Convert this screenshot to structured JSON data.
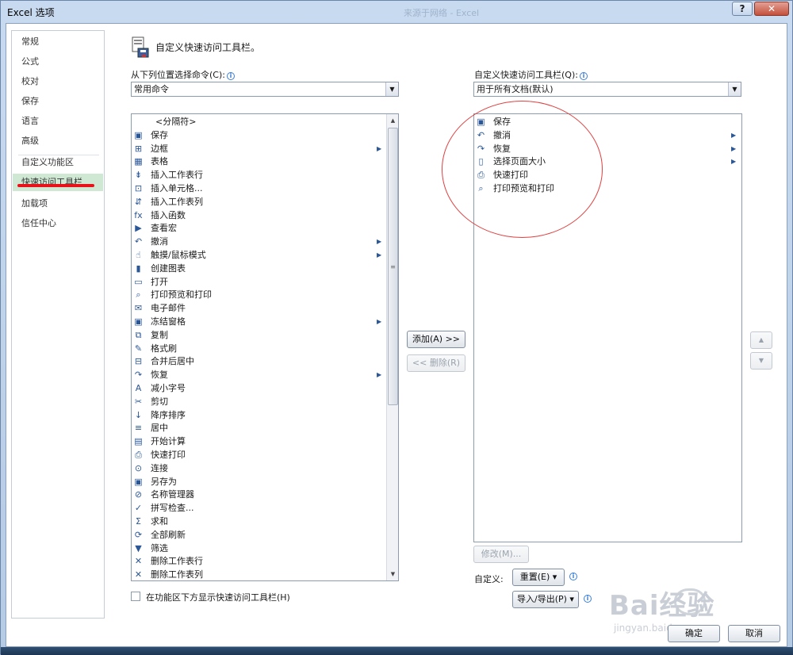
{
  "window": {
    "title": "Excel 选项",
    "ghost_title": "来源于网络 - Excel",
    "help_label": "?",
    "close_label": "✕"
  },
  "sidebar": {
    "items": [
      {
        "label": "常规"
      },
      {
        "label": "公式"
      },
      {
        "label": "校对"
      },
      {
        "label": "保存"
      },
      {
        "label": "语言"
      },
      {
        "label": "高级"
      },
      {
        "label": "自定义功能区"
      },
      {
        "label": "快速访问工具栏",
        "active": true
      },
      {
        "label": "加载项"
      },
      {
        "label": "信任中心"
      }
    ]
  },
  "header": {
    "title": "自定义快速访问工具栏。"
  },
  "left_panel": {
    "label": "从下列位置选择命令(C):",
    "combo_value": "常用命令",
    "commands": [
      {
        "label": "<分隔符>",
        "icon": "separator-icon",
        "glyph": ""
      },
      {
        "label": "保存",
        "icon": "save-icon",
        "glyph": "▣"
      },
      {
        "label": "边框",
        "icon": "border-icon",
        "glyph": "⊞",
        "submenu": true
      },
      {
        "label": "表格",
        "icon": "table-icon",
        "glyph": "▦"
      },
      {
        "label": "插入工作表行",
        "icon": "insert-row-icon",
        "glyph": "⇟"
      },
      {
        "label": "插入单元格...",
        "icon": "insert-cells-icon",
        "glyph": "⊡"
      },
      {
        "label": "插入工作表列",
        "icon": "insert-column-icon",
        "glyph": "⇵"
      },
      {
        "label": "插入函数",
        "icon": "function-icon",
        "glyph": "fx"
      },
      {
        "label": "查看宏",
        "icon": "macro-icon",
        "glyph": "▶"
      },
      {
        "label": "撤消",
        "icon": "undo-icon",
        "glyph": "↶",
        "submenu": true
      },
      {
        "label": "触摸/鼠标模式",
        "icon": "touch-mode-icon",
        "glyph": "☝",
        "submenu": true
      },
      {
        "label": "创建图表",
        "icon": "chart-icon",
        "glyph": "▮"
      },
      {
        "label": "打开",
        "icon": "open-folder-icon",
        "glyph": "▭"
      },
      {
        "label": "打印预览和打印",
        "icon": "print-preview-icon",
        "glyph": "⌕"
      },
      {
        "label": "电子邮件",
        "icon": "email-icon",
        "glyph": "✉"
      },
      {
        "label": "冻结窗格",
        "icon": "freeze-panes-icon",
        "glyph": "▣",
        "submenu": true
      },
      {
        "label": "复制",
        "icon": "copy-icon",
        "glyph": "⧉"
      },
      {
        "label": "格式刷",
        "icon": "format-painter-icon",
        "glyph": "✎"
      },
      {
        "label": "合并后居中",
        "icon": "merge-center-icon",
        "glyph": "⊟"
      },
      {
        "label": "恢复",
        "icon": "redo-icon",
        "glyph": "↷",
        "submenu": true
      },
      {
        "label": "减小字号",
        "icon": "decrease-font-icon",
        "glyph": "A"
      },
      {
        "label": "剪切",
        "icon": "cut-icon",
        "glyph": "✂"
      },
      {
        "label": "降序排序",
        "icon": "sort-desc-icon",
        "glyph": "↓"
      },
      {
        "label": "居中",
        "icon": "align-center-icon",
        "glyph": "≡"
      },
      {
        "label": "开始计算",
        "icon": "calculate-icon",
        "glyph": "▤"
      },
      {
        "label": "快速打印",
        "icon": "quick-print-icon",
        "glyph": "⎙"
      },
      {
        "label": "连接",
        "icon": "connections-icon",
        "glyph": "⊙"
      },
      {
        "label": "另存为",
        "icon": "save-as-icon",
        "glyph": "▣"
      },
      {
        "label": "名称管理器",
        "icon": "name-manager-icon",
        "glyph": "⊘"
      },
      {
        "label": "拼写检查...",
        "icon": "spelling-icon",
        "glyph": "✓"
      },
      {
        "label": "求和",
        "icon": "sum-icon",
        "glyph": "Σ"
      },
      {
        "label": "全部刷新",
        "icon": "refresh-all-icon",
        "glyph": "⟳"
      },
      {
        "label": "筛选",
        "icon": "filter-icon",
        "glyph": "▼"
      },
      {
        "label": "删除工作表行",
        "icon": "delete-row-icon",
        "glyph": "✕"
      },
      {
        "label": "删除工作表列",
        "icon": "delete-column-icon",
        "glyph": "✕"
      }
    ]
  },
  "middle": {
    "add_label": "添加(A) >>",
    "remove_label": "<< 删除(R)"
  },
  "right_panel": {
    "label": "自定义快速访问工具栏(Q):",
    "combo_value": "用于所有文档(默认)",
    "commands": [
      {
        "label": "保存",
        "icon": "save-icon",
        "glyph": "▣"
      },
      {
        "label": "撤消",
        "icon": "undo-icon",
        "glyph": "↶",
        "submenu": true
      },
      {
        "label": "恢复",
        "icon": "redo-icon",
        "glyph": "↷",
        "submenu": true
      },
      {
        "label": "选择页面大小",
        "icon": "page-size-icon",
        "glyph": "▯",
        "submenu": true
      },
      {
        "label": "快速打印",
        "icon": "quick-print-icon",
        "glyph": "⎙"
      },
      {
        "label": "打印预览和打印",
        "icon": "print-preview-icon",
        "glyph": "⌕"
      }
    ],
    "modify_label": "修改(M)...",
    "customize_label": "自定义:",
    "reset_label": "重置(E) ▾",
    "import_export_label": "导入/导出(P) ▾"
  },
  "footer": {
    "checkbox_label": "在功能区下方显示快速访问工具栏(H)",
    "ok_label": "确定",
    "cancel_label": "取消"
  },
  "watermark": {
    "brand": "Bai经验",
    "url": "jingyan.baidu.com"
  },
  "colors": {
    "active_nav": "#cfe8d3",
    "annotation_red": "#e8131a"
  }
}
